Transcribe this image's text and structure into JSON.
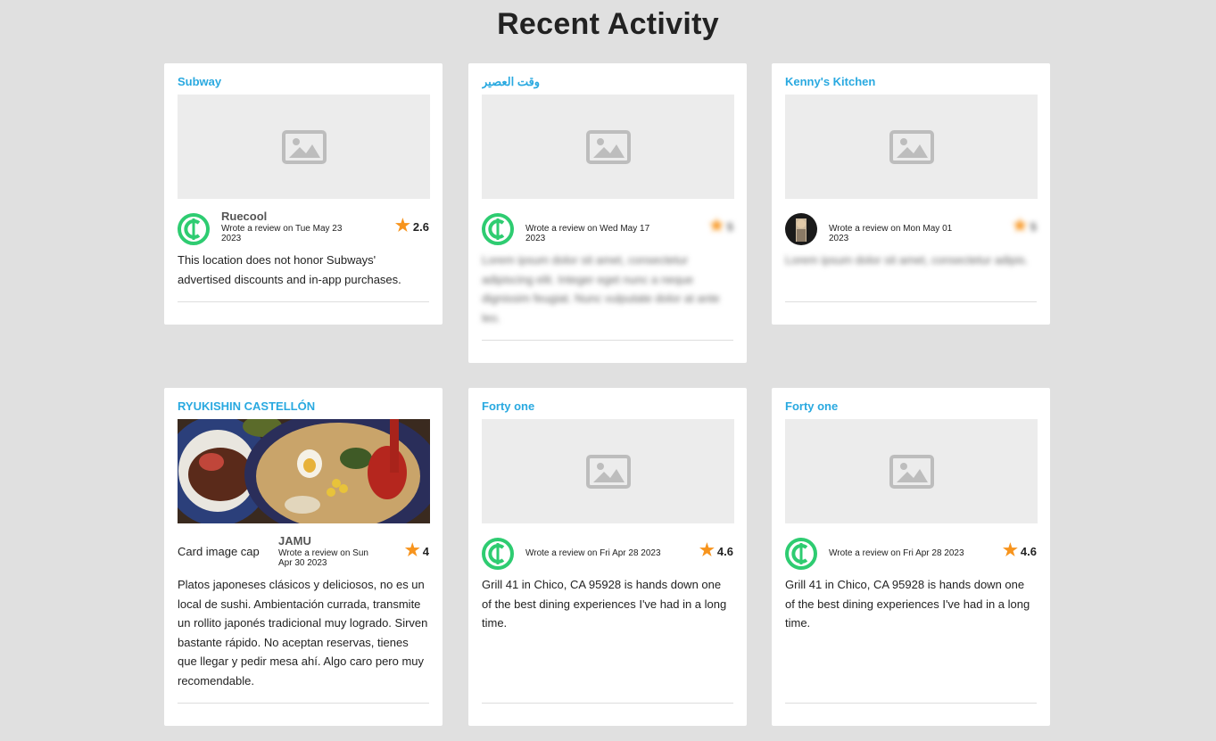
{
  "page": {
    "title": "Recent Activity"
  },
  "colors": {
    "accent": "#29a9e0",
    "star": "#f7941d",
    "avatar_green": "#2ecc71"
  },
  "cards": [
    {
      "restaurant": "Subway",
      "image_alt": "",
      "reviewer": "Ruecool",
      "date": "Wrote a review on Tue May 23 2023",
      "rating": "2.6",
      "text": "This location does not honor Subways' advertised discounts and in-app purchases."
    },
    {
      "restaurant": "وقت العصير",
      "reviewer": "",
      "date": "Wrote a review on Wed May 17 2023",
      "rating": "5",
      "text": "Lorem ipsum dolor sit amet, consectetur adipiscing elit. Integer eget nunc a neque dignissim feugiat. Nunc vulputate dolor at ante leo."
    },
    {
      "restaurant": "Kenny's Kitchen",
      "reviewer": "",
      "date": "Wrote a review on Mon May 01 2023",
      "rating": "5",
      "text": "Lorem ipsum dolor sit amet, consectetur adipis."
    },
    {
      "restaurant": "RYUKISHIN CASTELLÓN",
      "image_alt": "Card image cap",
      "reviewer": "JAMU",
      "date": "Wrote a review on Sun Apr 30 2023",
      "rating": "4",
      "text": "Platos japoneses clásicos y deliciosos, no es un local de sushi. Ambientación currada, transmite un rollito japonés tradicional muy logrado. Sirven bastante rápido. No aceptan reservas, tienes que llegar y pedir mesa ahí. Algo caro pero muy recomendable."
    },
    {
      "restaurant": "Forty one",
      "reviewer": "",
      "date": "Wrote a review on Fri Apr 28 2023",
      "rating": "4.6",
      "text": "Grill 41 in Chico, CA 95928 is hands down one of the best dining experiences I've had in a long time."
    },
    {
      "restaurant": "Forty one",
      "reviewer": "",
      "date": "Wrote a review on Fri Apr 28 2023",
      "rating": "4.6",
      "text": "Grill 41 in Chico, CA 95928 is hands down one of the best dining experiences I've had in a long time."
    }
  ]
}
